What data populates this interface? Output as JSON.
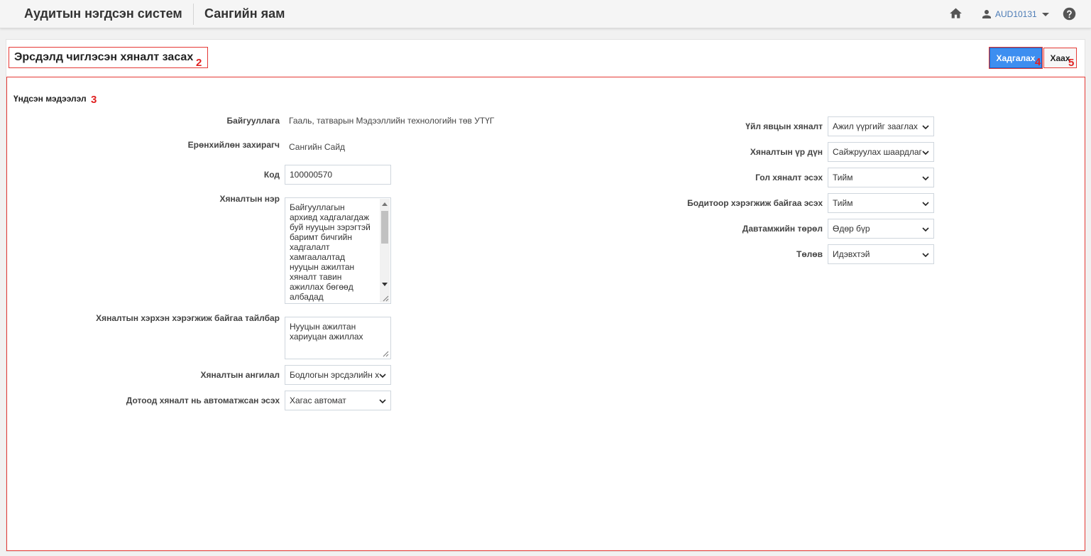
{
  "header": {
    "app_title": "Аудитын нэгдсэн систем",
    "org_title": "Сангийн яам",
    "user_name": "AUD10131"
  },
  "page": {
    "title": "Эрсдэлд чиглэсэн хяналт засах",
    "save_label": "Хадгалах",
    "close_label": "Хаах",
    "section_title": "Үндсэн мэдээлэл",
    "markers": {
      "title": "2",
      "section": "3",
      "save": "4",
      "close": "5"
    }
  },
  "form_left": {
    "org_label": "Байгууллага",
    "org_value": "Гааль, татварын Мэдээллийн технологийн төв УТҮГ",
    "director_label": "Ерөнхийлөн захирагч",
    "director_value": "Сангийн Сайд",
    "code_label": "Код",
    "code_value": "100000570",
    "control_name_label": "Хяналтын нэр",
    "control_name_lines": [
      "Байгууллагын",
      "архивд хадгалагдаж",
      "буй нууцын зэрэгтэй",
      "баримт бичгийн",
      "хадгалалт",
      "хамгаалалтад",
      "нууцын ажилтан",
      "хяналт тавин",
      "ажиллах бөгөөд",
      "албадад"
    ],
    "implementation_label": "Хяналтын хэрхэн хэрэгжиж байгаа тайлбар",
    "implementation_lines": [
      "Нууцын ажилтан",
      "хариуцан ажиллах"
    ],
    "classification_label": "Хяналтын ангилал",
    "classification_value": "Бодлогын эрсдэлийн х",
    "automated_label": "Дотоод хяналт нь автоматжсан эсэх",
    "automated_value": "Хагас автомат"
  },
  "form_right": {
    "process_label": "Үйл явцын хяналт",
    "process_value": "Ажил үүргийг зааглах",
    "result_label": "Хяналтын үр дүн",
    "result_value": "Сайжруулах шаардлаг",
    "key_label": "Гол хяналт эсэх",
    "key_value": "Тийм",
    "actual_label": "Бодитоор хэрэгжиж байгаа эсэх",
    "actual_value": "Тийм",
    "frequency_label": "Давтамжийн төрөл",
    "frequency_value": "Өдөр бүр",
    "status_label": "Төлөв",
    "status_value": "Идэвхтэй"
  }
}
